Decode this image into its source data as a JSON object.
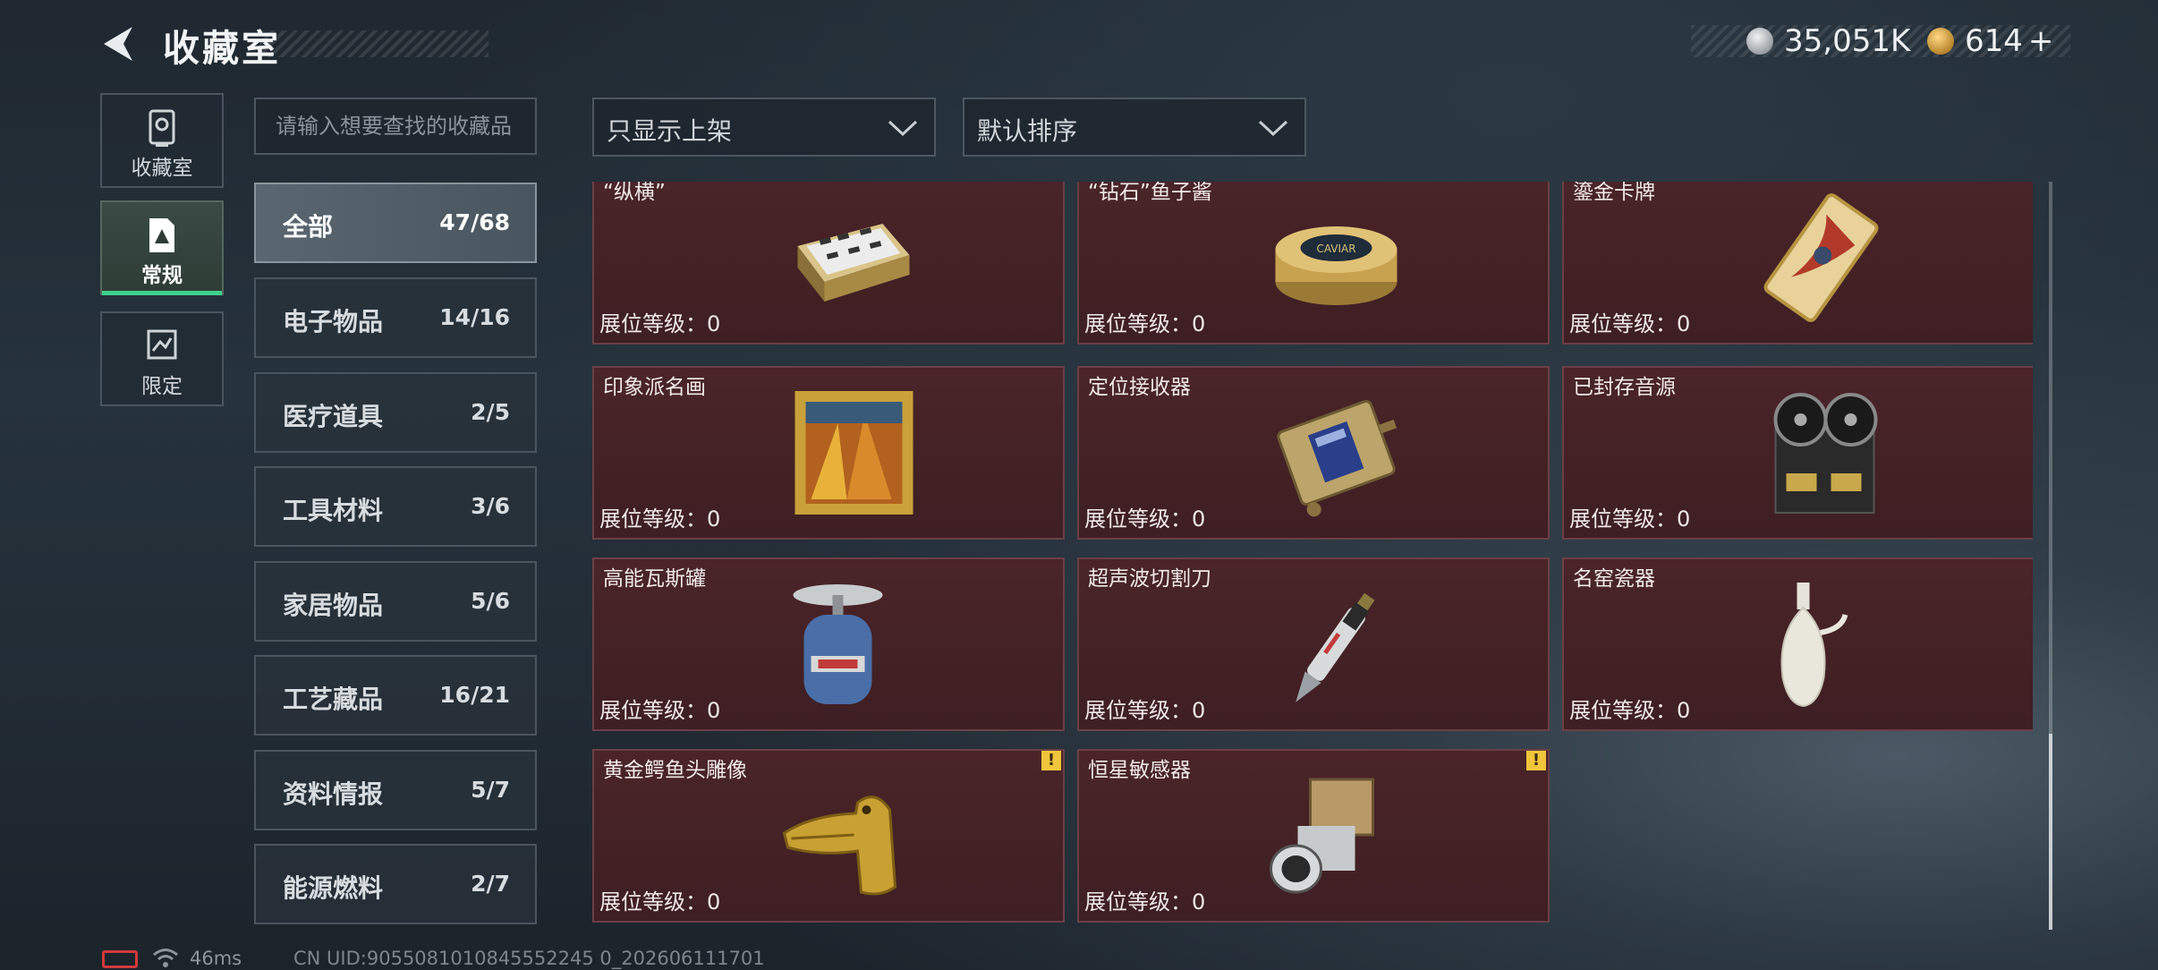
{
  "header": {
    "title": "收藏室",
    "currency": [
      {
        "icon": "silver-coin-icon",
        "value": "35,051K"
      },
      {
        "icon": "gold-coin-icon",
        "value": "614"
      }
    ],
    "add_label": "+"
  },
  "left_nav": [
    {
      "label": "收藏室",
      "icon": "collection-room-icon",
      "active": false
    },
    {
      "label": "常规",
      "icon": "regular-icon",
      "active": true
    },
    {
      "label": "限定",
      "icon": "limited-icon",
      "active": false
    }
  ],
  "search": {
    "placeholder": "请输入想要查找的收藏品"
  },
  "filters": {
    "shelf_filter": "只显示上架",
    "sort": "默认排序"
  },
  "categories": [
    {
      "name": "全部",
      "count": "47/68",
      "active": true
    },
    {
      "name": "电子物品",
      "count": "14/16"
    },
    {
      "name": "医疗道具",
      "count": "2/5"
    },
    {
      "name": "工具材料",
      "count": "3/6"
    },
    {
      "name": "家居物品",
      "count": "5/6"
    },
    {
      "name": "工艺藏品",
      "count": "16/21"
    },
    {
      "name": "资料情报",
      "count": "5/7"
    },
    {
      "name": "能源燃料",
      "count": "2/7"
    }
  ],
  "items": [
    {
      "name": "“纵横”",
      "level": "展位等级：0",
      "icon": "chess-box-icon"
    },
    {
      "name": "“钻石”鱼子酱",
      "level": "展位等级：0",
      "icon": "caviar-tin-icon"
    },
    {
      "name": "鎏金卡牌",
      "level": "展位等级：0",
      "icon": "gilded-card-icon"
    },
    {
      "name": "印象派名画",
      "level": "展位等级：0",
      "icon": "framed-painting-icon"
    },
    {
      "name": "定位接收器",
      "level": "展位等级：0",
      "icon": "locator-receiver-icon"
    },
    {
      "name": "已封存音源",
      "level": "展位等级：0",
      "icon": "reel-recorder-icon"
    },
    {
      "name": "高能瓦斯罐",
      "level": "展位等级：0",
      "icon": "gas-canister-icon"
    },
    {
      "name": "超声波切割刀",
      "level": "展位等级：0",
      "icon": "ultrasonic-knife-icon"
    },
    {
      "name": "名窑瓷器",
      "level": "展位等级：0",
      "icon": "porcelain-vase-icon"
    },
    {
      "name": "黄金鳄鱼头雕像",
      "level": "展位等级：0",
      "icon": "golden-crocodile-icon",
      "warning": "!"
    },
    {
      "name": "恒星敏感器",
      "level": "展位等级：0",
      "icon": "star-sensor-icon",
      "warning": "!"
    }
  ],
  "footer": {
    "ping": "46ms",
    "uid": "CN UID:9055081010845552245 0_202606111701"
  },
  "colors": {
    "accent": "#3ed08c",
    "card_bg": "#4a2428",
    "warning": "#f0c53a",
    "battery": "#d23a3a"
  }
}
